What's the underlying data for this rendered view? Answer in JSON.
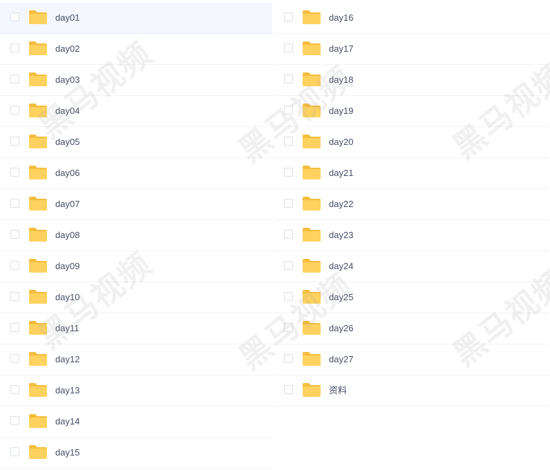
{
  "folders_left": [
    {
      "name": "day01",
      "selected": true
    },
    {
      "name": "day02"
    },
    {
      "name": "day03"
    },
    {
      "name": "day04"
    },
    {
      "name": "day05"
    },
    {
      "name": "day06"
    },
    {
      "name": "day07"
    },
    {
      "name": "day08"
    },
    {
      "name": "day09"
    },
    {
      "name": "day10"
    },
    {
      "name": "day11"
    },
    {
      "name": "day12"
    },
    {
      "name": "day13"
    },
    {
      "name": "day14"
    },
    {
      "name": "day15"
    }
  ],
  "folders_right": [
    {
      "name": "day16"
    },
    {
      "name": "day17"
    },
    {
      "name": "day18"
    },
    {
      "name": "day19"
    },
    {
      "name": "day20"
    },
    {
      "name": "day21"
    },
    {
      "name": "day22"
    },
    {
      "name": "day23"
    },
    {
      "name": "day24"
    },
    {
      "name": "day25"
    },
    {
      "name": "day26"
    },
    {
      "name": "day27"
    },
    {
      "name": "资料"
    }
  ],
  "watermark_text": "黑马视频",
  "icons": {
    "folder": "folder-icon",
    "checkbox": "checkbox-icon"
  },
  "colors": {
    "folder": "#ffd25f",
    "folder_tab": "#f5bd3e",
    "text": "#424e67",
    "selected_row": "#f4f8fe"
  }
}
